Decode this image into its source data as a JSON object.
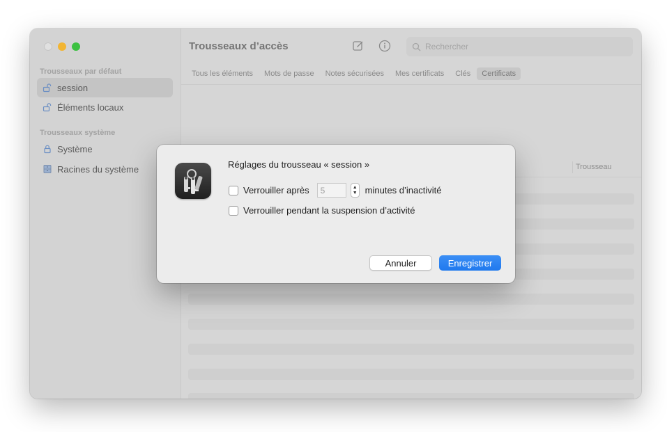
{
  "window": {
    "title": "Trousseaux d’accès",
    "search_placeholder": "Rechercher"
  },
  "sidebar": {
    "sections": [
      {
        "label": "Trousseaux par défaut"
      },
      {
        "label": "Trousseaux système"
      }
    ],
    "items": [
      {
        "label": "session",
        "icon": "unlock-icon",
        "selected": true
      },
      {
        "label": "Éléments locaux",
        "icon": "unlock-icon"
      },
      {
        "label": "Système",
        "icon": "lock-icon"
      },
      {
        "label": "Racines du système",
        "icon": "cabinet-icon"
      }
    ]
  },
  "tabs": [
    {
      "label": "Tous les éléments"
    },
    {
      "label": "Mots de passe"
    },
    {
      "label": "Notes sécurisées"
    },
    {
      "label": "Mes certificats"
    },
    {
      "label": "Clés"
    },
    {
      "label": "Certificats",
      "active": true
    }
  ],
  "table": {
    "column_keychain": "Trousseau"
  },
  "dialog": {
    "title": "Réglages du trousseau « session »",
    "lock_after_label": "Verrouiller après",
    "minutes_value": "5",
    "minutes_suffix": "minutes d’inactivité",
    "lock_sleep_label": "Verrouiller pendant la suspension d’activité",
    "cancel_label": "Annuler",
    "save_label": "Enregistrer"
  },
  "colors": {
    "accent": "#1f79ee",
    "traffic_min": "#f2b533",
    "traffic_max": "#3dc142"
  }
}
